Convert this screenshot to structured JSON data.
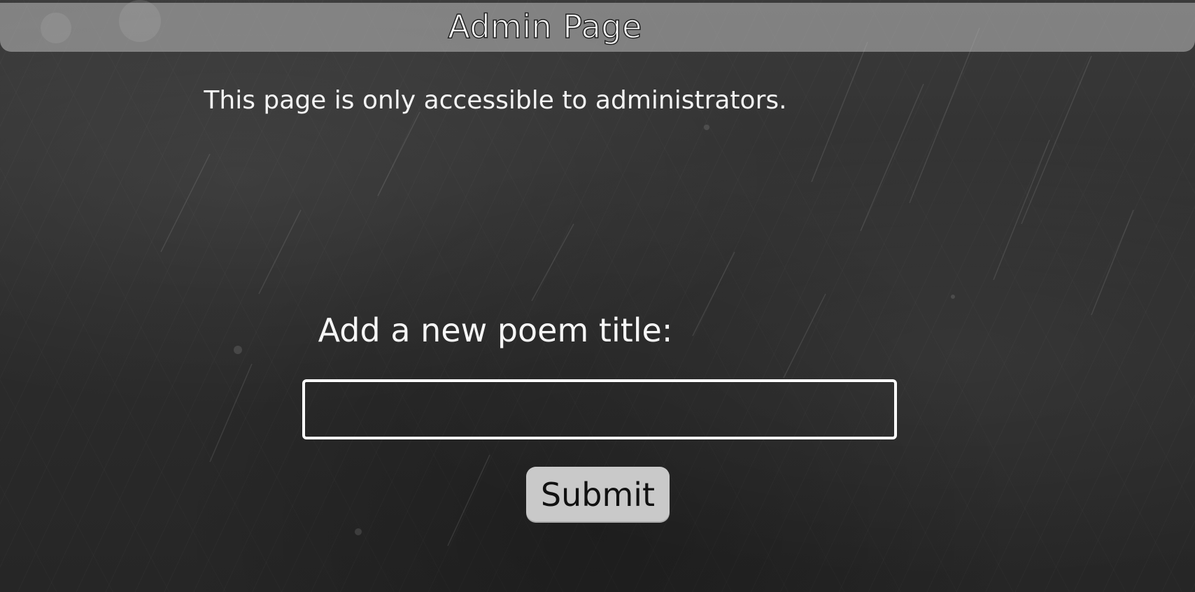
{
  "header": {
    "title": "Admin Page"
  },
  "main": {
    "subtitle": "This page is only accessible to administrators.",
    "form": {
      "label": "Add a new poem title:",
      "input_value": "",
      "submit_label": "Submit"
    }
  },
  "colors": {
    "background": "#2f2f2f",
    "header_bar": "#bebebe",
    "text": "#ffffff",
    "button_bg": "#c9c9c9",
    "button_text": "#111111"
  }
}
